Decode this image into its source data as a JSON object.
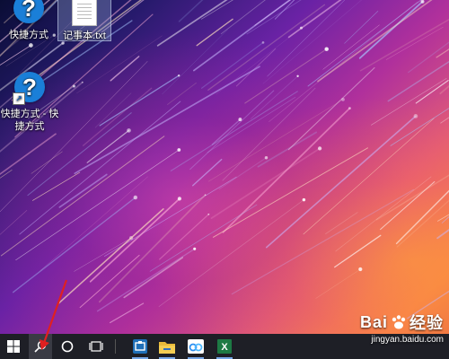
{
  "desktop": {
    "icons": [
      {
        "label": "快捷方式",
        "glyph": "?"
      },
      {
        "label": "记事本.txt"
      },
      {
        "label": "快捷方式 - 快捷方式",
        "glyph": "?"
      }
    ]
  },
  "taskbar": {
    "items": [
      {
        "name": "start",
        "icon": "windows-logo-icon"
      },
      {
        "name": "search",
        "icon": "search-icon"
      },
      {
        "name": "cortana",
        "icon": "cortana-circle-icon"
      },
      {
        "name": "task-view",
        "icon": "task-view-icon"
      },
      {
        "name": "screenpresso",
        "icon": "screenpresso-icon"
      },
      {
        "name": "file-explorer",
        "icon": "folder-icon"
      },
      {
        "name": "baidu-netdisk",
        "icon": "cloud-icon"
      },
      {
        "name": "excel",
        "icon": "excel-icon",
        "glyph": "X"
      }
    ]
  },
  "watermark": {
    "main_left": "Bai",
    "main_right": "经验",
    "sub": "jingyan.baidu.com"
  },
  "colors": {
    "taskbar_bg": "#1e1f26",
    "shortcut_icon_blue": "#1a7fd8",
    "annotation_red": "#e02020"
  }
}
